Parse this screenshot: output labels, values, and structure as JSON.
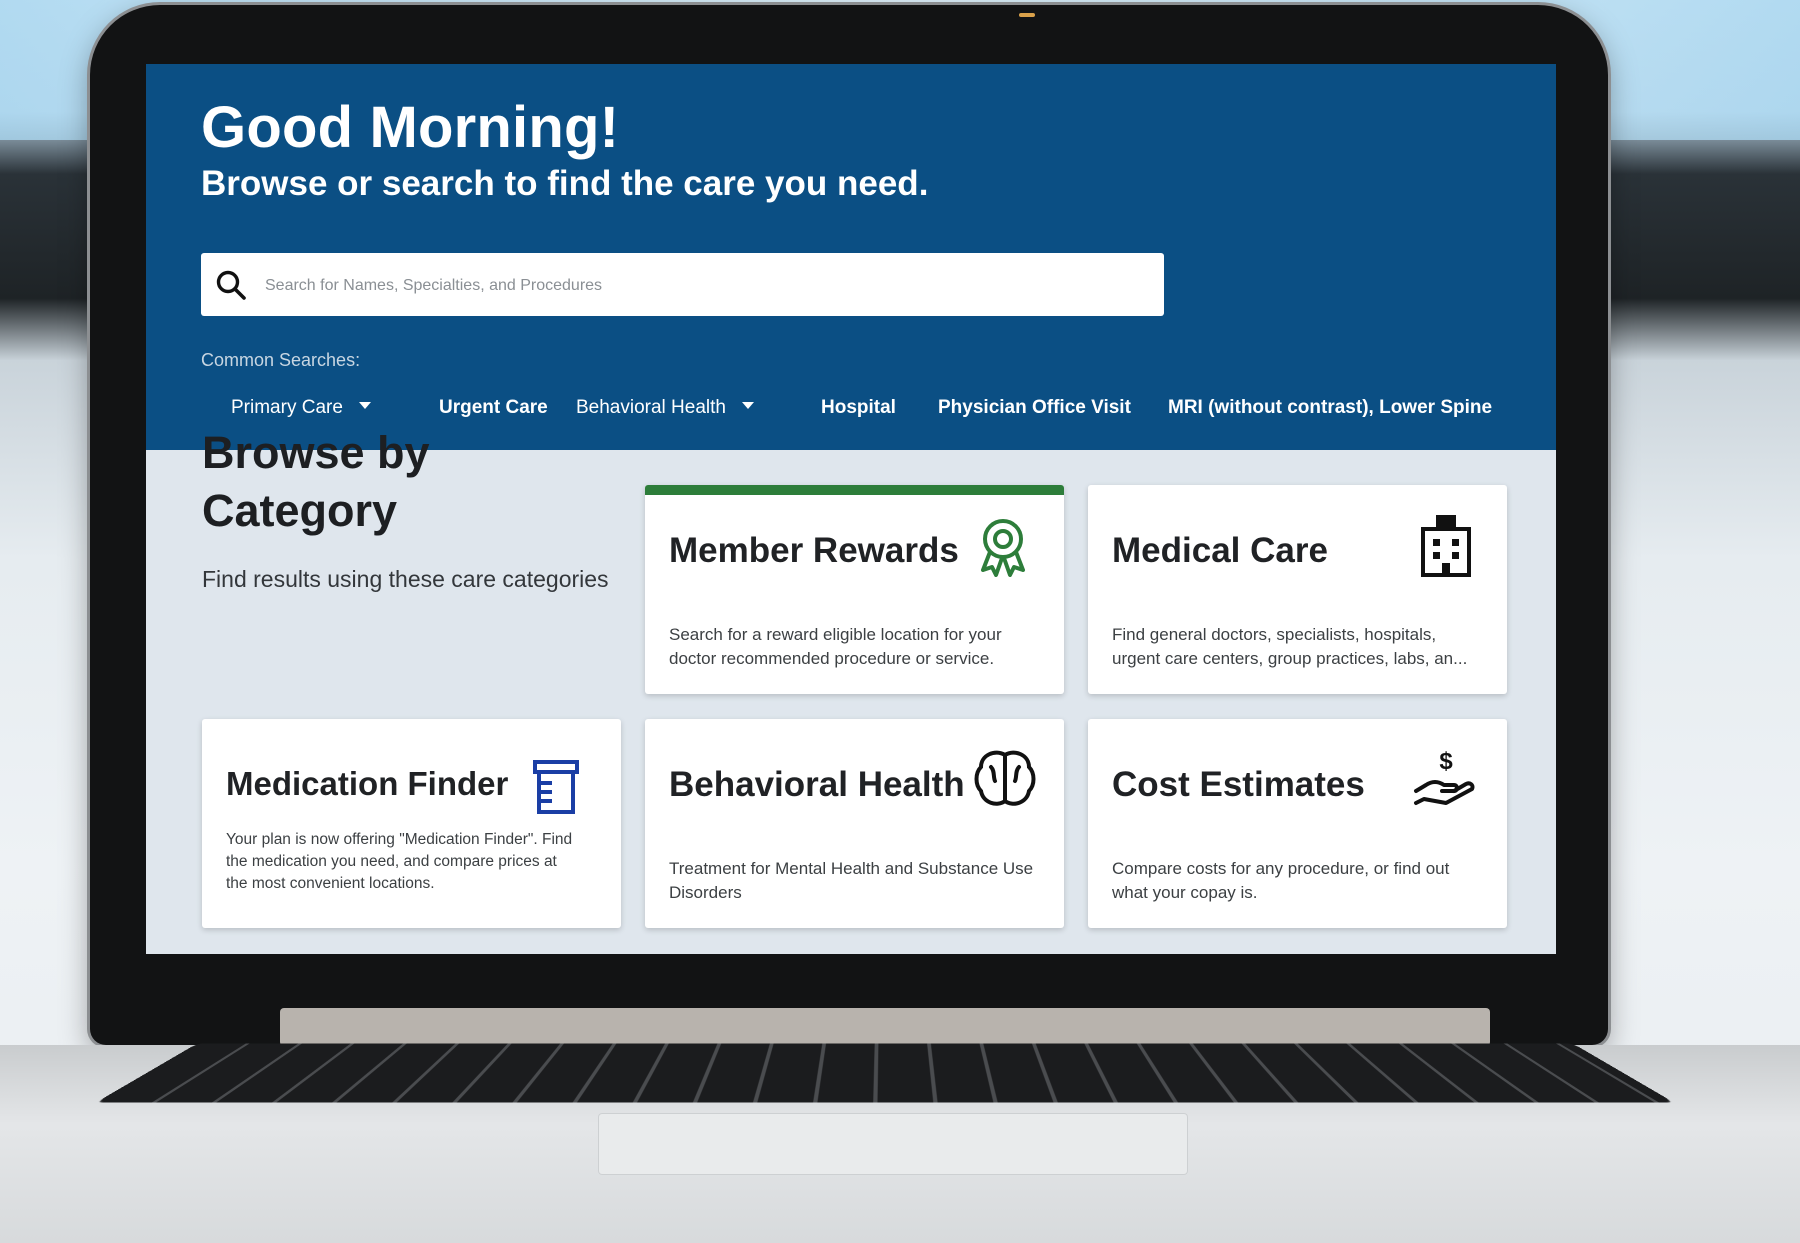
{
  "hero": {
    "greeting": "Good Morning!",
    "subtitle": "Browse or search to find the care you need.",
    "search": {
      "placeholder": "Search for Names, Specialties, and Procedures",
      "icon": "search-icon"
    },
    "common_label": "Common Searches:",
    "common_searches": [
      {
        "label": "Primary Care",
        "dropdown": true
      },
      {
        "label": "Urgent Care",
        "dropdown": false
      },
      {
        "label": "Behavioral Health",
        "dropdown": true
      },
      {
        "label": "Hospital",
        "dropdown": false
      },
      {
        "label": "Physician Office Visit",
        "dropdown": false
      },
      {
        "label": "MRI (without contrast), Lower Spine",
        "dropdown": false
      }
    ]
  },
  "browse": {
    "title": "Browse by Category",
    "description": "Find results using these care categories"
  },
  "cards": [
    {
      "title": "Member Rewards",
      "description": "Search for a reward eligible location for your doctor recommended procedure or service.",
      "icon": "ribbon-award-icon",
      "icon_color": "#2d7d3a"
    },
    {
      "title": "Medical Care",
      "description": "Find general doctors, specialists, hospitals, urgent care centers, group practices, labs, an...",
      "icon": "hospital-building-icon",
      "icon_color": "#111111"
    },
    {
      "title": "Medication Finder",
      "description": "Your plan is now offering \"Medication Finder\". Find the medication you need, and compare prices at the most convenient locations.",
      "icon": "pill-bottle-icon",
      "icon_color": "#1a3ea5"
    },
    {
      "title": "Behavioral Health",
      "description": "Treatment for Mental Health and Substance Use Disorders",
      "icon": "brain-icon",
      "icon_color": "#111111"
    },
    {
      "title": "Cost Estimates",
      "description": "Compare costs for any procedure, or find out what your copay is.",
      "icon": "hand-dollar-icon",
      "icon_color": "#111111"
    }
  ],
  "colors": {
    "hero_background": "#0b4f84",
    "accent_green": "#2d7d3a",
    "page_background": "#dfe6ed"
  }
}
